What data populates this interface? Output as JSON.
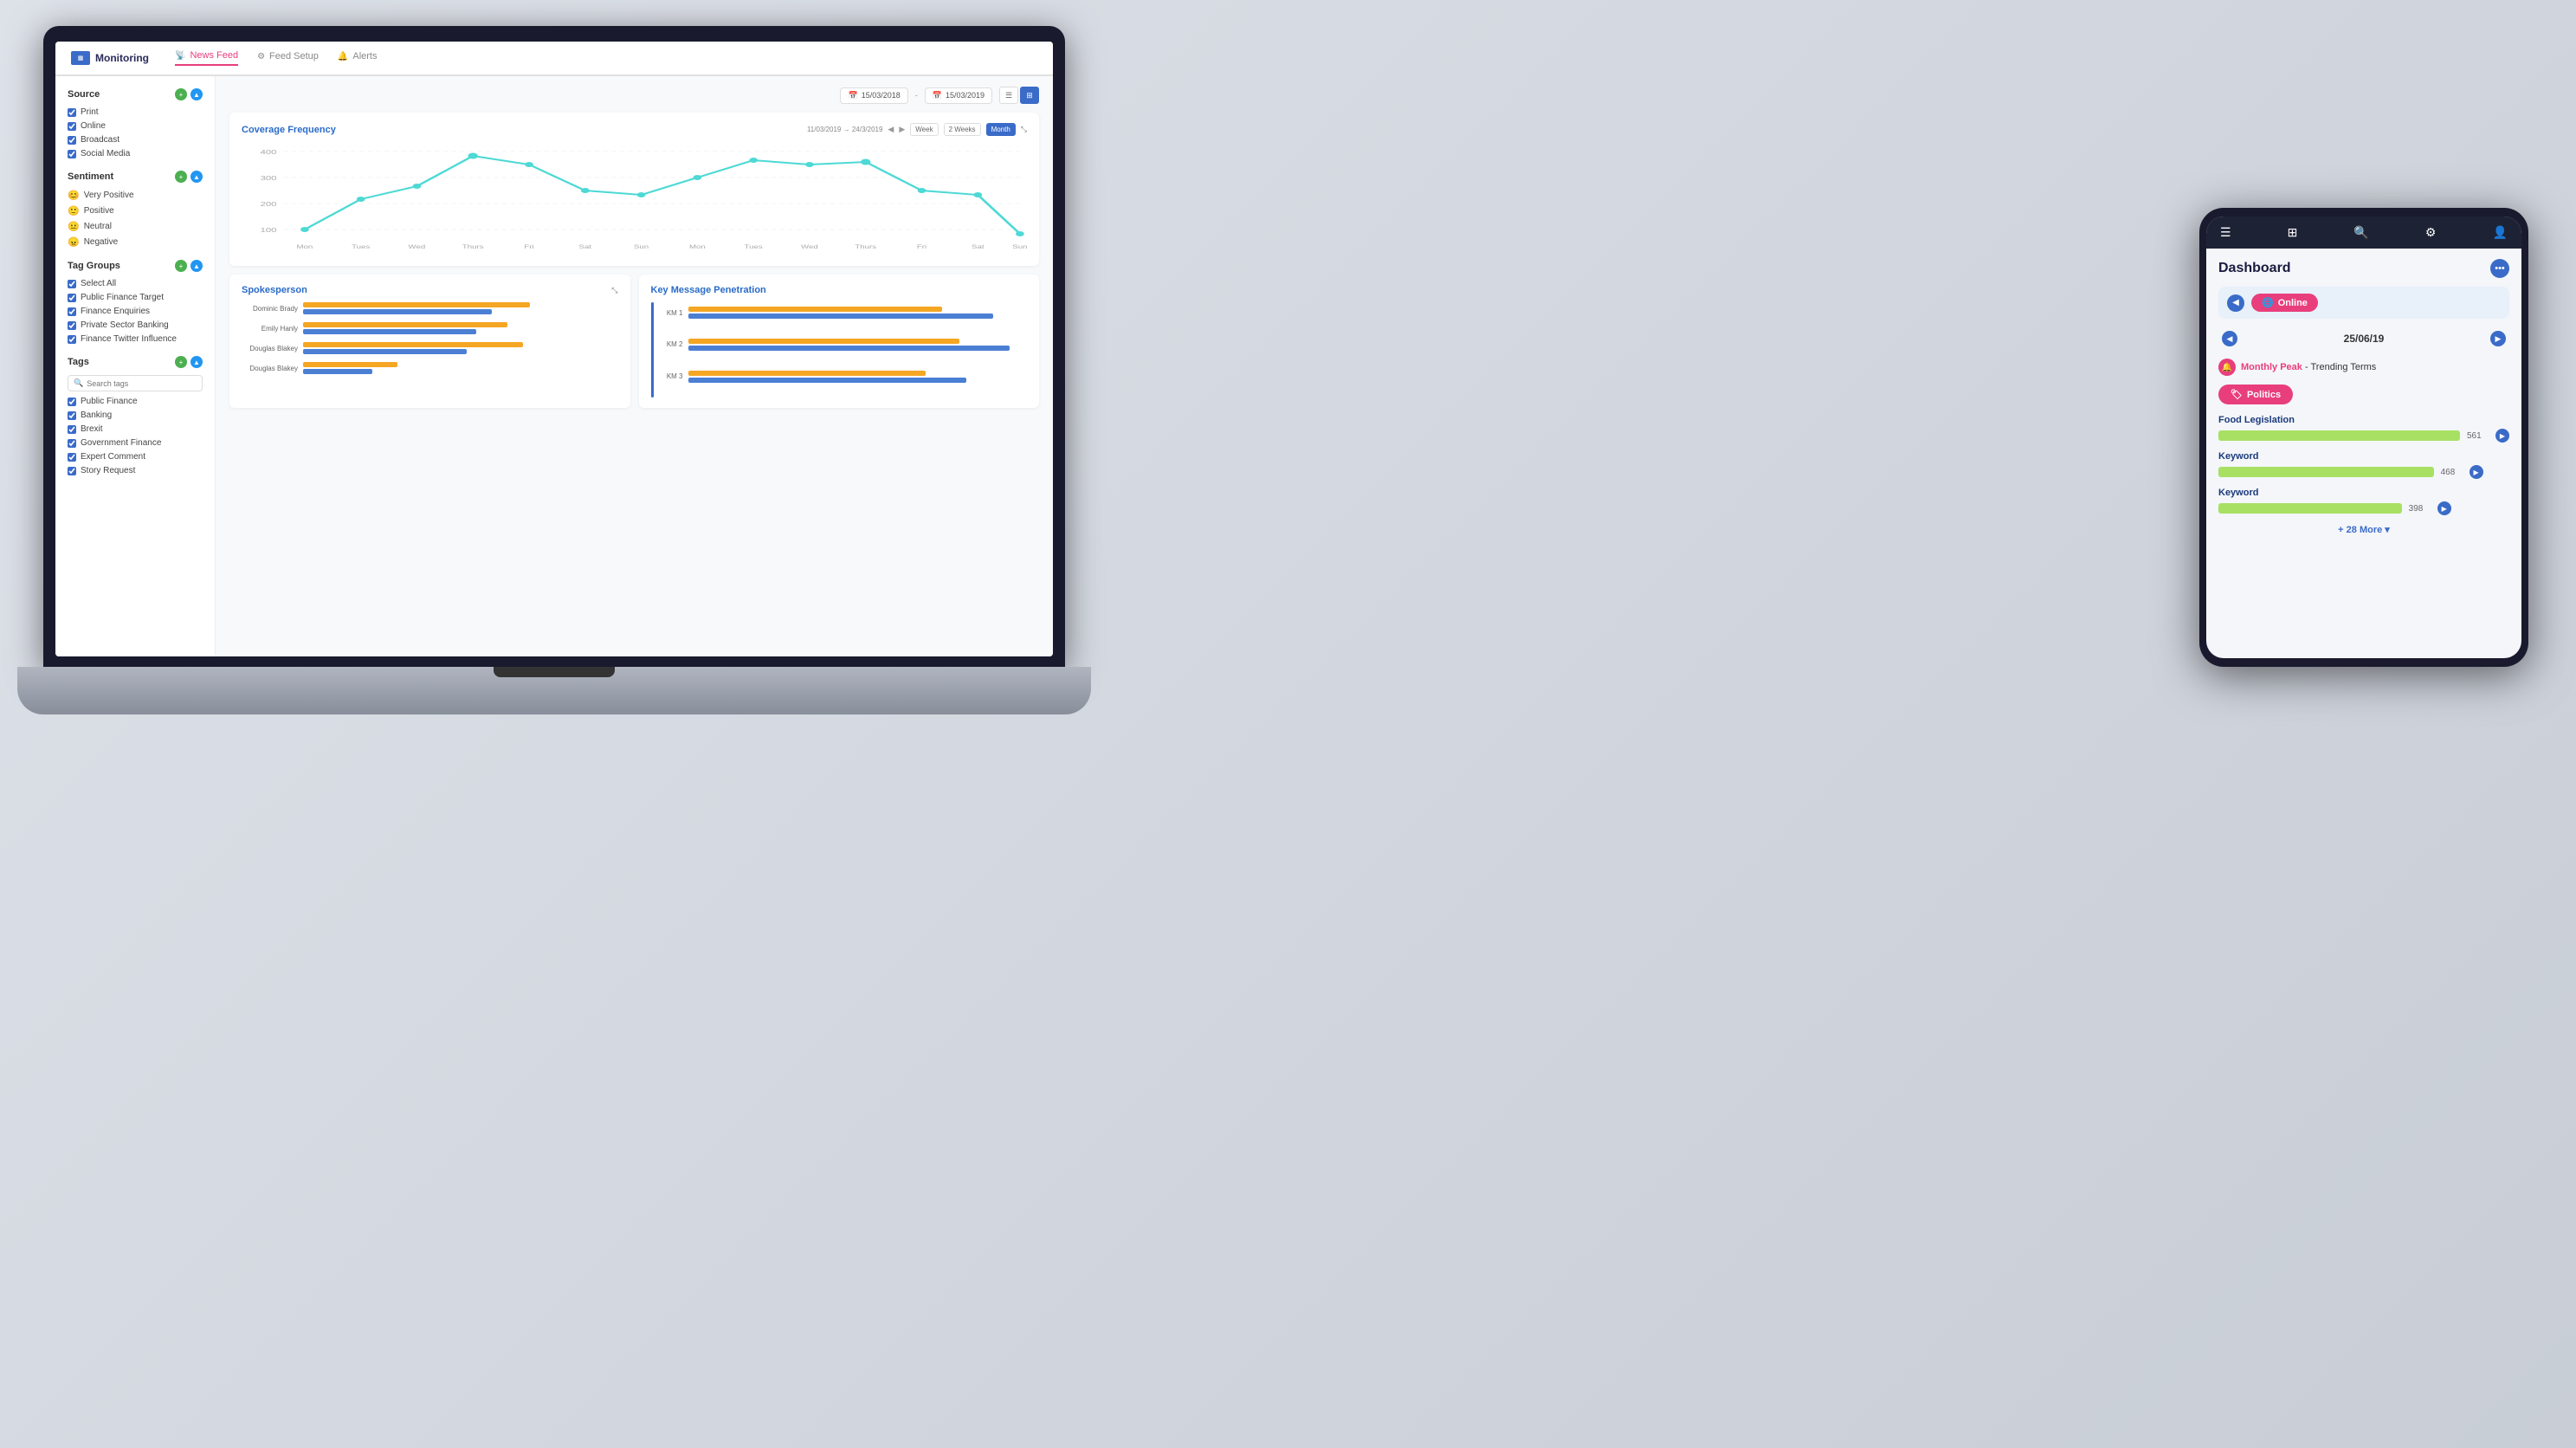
{
  "brand": {
    "name": "Monitoring"
  },
  "nav": {
    "items": [
      {
        "label": "News Feed",
        "active": true,
        "icon": "📡"
      },
      {
        "label": "Feed Setup",
        "active": false,
        "icon": "⚙"
      },
      {
        "label": "Alerts",
        "active": false,
        "icon": "🔔"
      }
    ]
  },
  "sidebar": {
    "source": {
      "title": "Source",
      "items": [
        "Print",
        "Online",
        "Broadcast",
        "Social Media"
      ]
    },
    "sentiment": {
      "title": "Sentiment",
      "items": [
        {
          "label": "Very Positive",
          "emoji": "😊"
        },
        {
          "label": "Positive",
          "emoji": "🙂"
        },
        {
          "label": "Neutral",
          "emoji": "😐"
        },
        {
          "label": "Negative",
          "emoji": "😠"
        }
      ]
    },
    "tagGroups": {
      "title": "Tag Groups",
      "items": [
        "Select All",
        "Public Finance Target",
        "Finance Enquiries",
        "Private Sector Banking",
        "Finance Twitter Influence"
      ]
    },
    "tags": {
      "title": "Tags",
      "search_placeholder": "Search tags",
      "items": [
        "Public Finance",
        "Banking",
        "Brexit",
        "Government Finance",
        "Expert Comment",
        "Story Request"
      ]
    }
  },
  "datebar": {
    "from": "15/03/2018",
    "to": "15/03/2019"
  },
  "coverage": {
    "title": "Coverage Frequency",
    "date_range": "11/03/2019 → 24/3/2019",
    "periods": [
      "Week",
      "2 Weeks",
      "Month"
    ],
    "active_period": "Month",
    "y_labels": [
      "400",
      "300",
      "200",
      "100"
    ],
    "x_labels": [
      "Mon",
      "Tues",
      "Wed",
      "Thurs",
      "Fri",
      "Sat",
      "Sun",
      "Mon",
      "Tues",
      "Wed",
      "Thurs",
      "Fri",
      "Sat",
      "Sun"
    ]
  },
  "spokesperson": {
    "title": "Spokesperson",
    "rows": [
      {
        "label": "Dominic Brady",
        "orange_pct": 72,
        "blue_pct": 60
      },
      {
        "label": "Emily Hanly",
        "orange_pct": 65,
        "blue_pct": 55
      },
      {
        "label": "Douglas Blakey",
        "orange_pct": 70,
        "blue_pct": 52
      },
      {
        "label": "Douglas Blakey",
        "orange_pct": 30,
        "blue_pct": 22
      }
    ]
  },
  "keyMessage": {
    "title": "Key Message Penetration",
    "rows": [
      {
        "label": "KM 1",
        "orange_pct": 75,
        "blue_pct": 90
      },
      {
        "label": "KM 2",
        "orange_pct": 80,
        "blue_pct": 95
      },
      {
        "label": "KM 3",
        "orange_pct": 70,
        "blue_pct": 82
      }
    ]
  },
  "tablet": {
    "title": "Dashboard",
    "source": "Online",
    "date": "25/06/19",
    "monthly_peak_label": "Monthly Peak",
    "trending_suffix": "- Trending Terms",
    "politics_label": "Politics",
    "trends": [
      {
        "label": "Food Legislation",
        "count": "561",
        "bar_pct": 88
      },
      {
        "label": "Keyword",
        "count": "468",
        "bar_pct": 74
      },
      {
        "label": "Keyword",
        "count": "398",
        "bar_pct": 63
      }
    ],
    "more_label": "+ 28 More"
  }
}
